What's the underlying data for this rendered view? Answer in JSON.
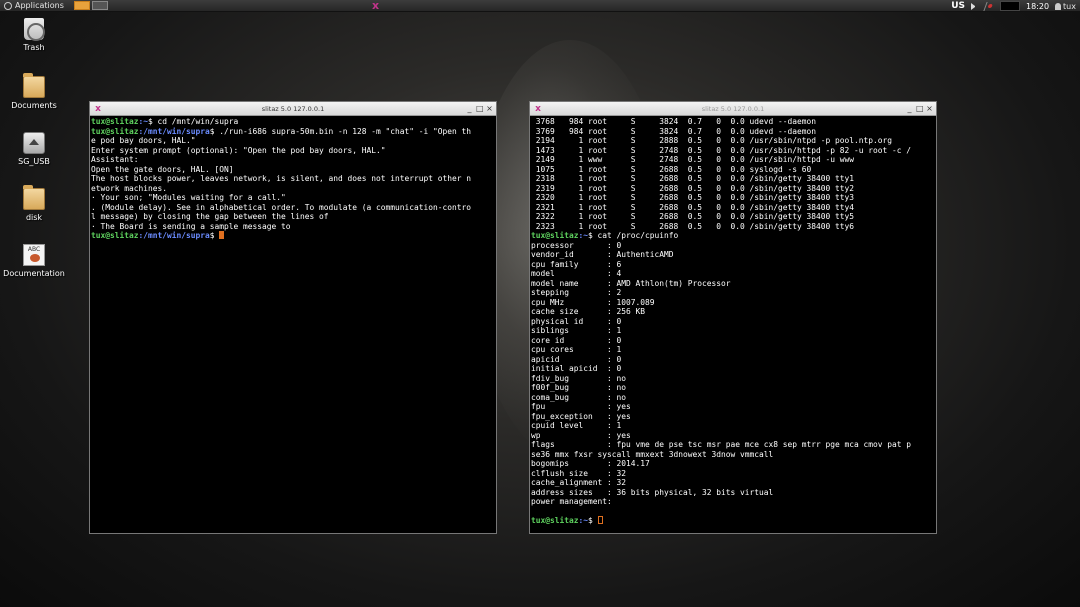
{
  "panel": {
    "applications_label": "Applications",
    "center_logo": "x",
    "keyboard_layout": "US",
    "clock": "18:20",
    "user": "tux"
  },
  "desktop_icons": [
    {
      "label": "Trash",
      "icon": "trash-icon"
    },
    {
      "label": "Documents",
      "icon": "folder-icon"
    },
    {
      "label": "SG_USB",
      "icon": "usb-drive-icon"
    },
    {
      "label": "disk",
      "icon": "folder-icon"
    },
    {
      "label": "Documentation",
      "icon": "documentation-icon",
      "badge": "ABC"
    }
  ],
  "window_left": {
    "title": "slitaz 5.0 127.0.0.1",
    "lines": [
      {
        "user": "tux@slitaz",
        "path": ":~",
        "cmd": "$ cd /mnt/win/supra"
      },
      {
        "user": "tux@slitaz",
        "path": ":/mnt/win/supra",
        "cmd": "$ ./run-i686 supra-50m.bin -n 128 -m \"chat\" -i \"Open th"
      },
      {
        "text": "e pod bay doors, HAL.\""
      },
      {
        "text": "Enter system prompt (optional): \"Open the pod bay doors, HAL.\""
      },
      {
        "text": "Assistant:"
      },
      {
        "text": "Open the gate doors, HAL. [ON]"
      },
      {
        "text": "The host blocks power, leaves network, is silent, and does not interrupt other n"
      },
      {
        "text": "etwork machines."
      },
      {
        "text": "· Your son; \"Modules waiting for a call.\""
      },
      {
        "text": ". (Module delay). See in alphabetical order. To modulate (a communication-contro"
      },
      {
        "text": "l message) by closing the gap between the lines of"
      },
      {
        "text": "· The Board is sending a sample message to"
      },
      {
        "user": "tux@slitaz",
        "path": ":/mnt/win/supra",
        "cmd": "$ ",
        "cursor": true
      }
    ]
  },
  "window_right": {
    "title": "slitaz 5.0 127.0.0.1",
    "lines": [
      {
        "text": " 3768   984 root     S     3824  0.7   0  0.0 udevd --daemon"
      },
      {
        "text": " 3769   984 root     S     3824  0.7   0  0.0 udevd --daemon"
      },
      {
        "text": " 2194     1 root     S     2888  0.5   0  0.0 /usr/sbin/ntpd -p pool.ntp.org"
      },
      {
        "text": " 1473     1 root     S     2748  0.5   0  0.0 /usr/sbin/httpd -p 82 -u root -c /"
      },
      {
        "text": " 2149     1 www      S     2748  0.5   0  0.0 /usr/sbin/httpd -u www"
      },
      {
        "text": " 1075     1 root     S     2688  0.5   0  0.0 syslogd -s 60"
      },
      {
        "text": " 2318     1 root     S     2688  0.5   0  0.0 /sbin/getty 38400 tty1"
      },
      {
        "text": " 2319     1 root     S     2688  0.5   0  0.0 /sbin/getty 38400 tty2"
      },
      {
        "text": " 2320     1 root     S     2688  0.5   0  0.0 /sbin/getty 38400 tty3"
      },
      {
        "text": " 2321     1 root     S     2688  0.5   0  0.0 /sbin/getty 38400 tty4"
      },
      {
        "text": " 2322     1 root     S     2688  0.5   0  0.0 /sbin/getty 38400 tty5"
      },
      {
        "text": " 2323     1 root     S     2688  0.5   0  0.0 /sbin/getty 38400 tty6"
      },
      {
        "user": "tux@slitaz",
        "path": ":~",
        "cmd": "$ cat /proc/cpuinfo"
      },
      {
        "text": "processor       : 0"
      },
      {
        "text": "vendor_id       : AuthenticAMD"
      },
      {
        "text": "cpu family      : 6"
      },
      {
        "text": "model           : 4"
      },
      {
        "text": "model name      : AMD Athlon(tm) Processor"
      },
      {
        "text": "stepping        : 2"
      },
      {
        "text": "cpu MHz         : 1007.089"
      },
      {
        "text": "cache size      : 256 KB"
      },
      {
        "text": "physical id     : 0"
      },
      {
        "text": "siblings        : 1"
      },
      {
        "text": "core id         : 0"
      },
      {
        "text": "cpu cores       : 1"
      },
      {
        "text": "apicid          : 0"
      },
      {
        "text": "initial apicid  : 0"
      },
      {
        "text": "fdiv_bug        : no"
      },
      {
        "text": "f00f_bug        : no"
      },
      {
        "text": "coma_bug        : no"
      },
      {
        "text": "fpu             : yes"
      },
      {
        "text": "fpu_exception   : yes"
      },
      {
        "text": "cpuid level     : 1"
      },
      {
        "text": "wp              : yes"
      },
      {
        "text": "flags           : fpu vme de pse tsc msr pae mce cx8 sep mtrr pge mca cmov pat p"
      },
      {
        "text": "se36 mmx fxsr syscall mmxext 3dnowext 3dnow vmmcall"
      },
      {
        "text": "bogomips        : 2014.17"
      },
      {
        "text": "clflush size    : 32"
      },
      {
        "text": "cache_alignment : 32"
      },
      {
        "text": "address sizes   : 36 bits physical, 32 bits virtual"
      },
      {
        "text": "power management:"
      },
      {
        "text": ""
      },
      {
        "user": "tux@slitaz",
        "path": ":~",
        "cmd": "$ ",
        "cursor": true,
        "hollow": true
      }
    ]
  },
  "window_buttons": {
    "minimize": "_",
    "maximize": "□",
    "close": "×"
  },
  "colors": {
    "prompt_user": "#5fd35f",
    "prompt_path": "#6b8cff",
    "cursor": "#e07020",
    "workspace_active": "#e8a23c"
  }
}
